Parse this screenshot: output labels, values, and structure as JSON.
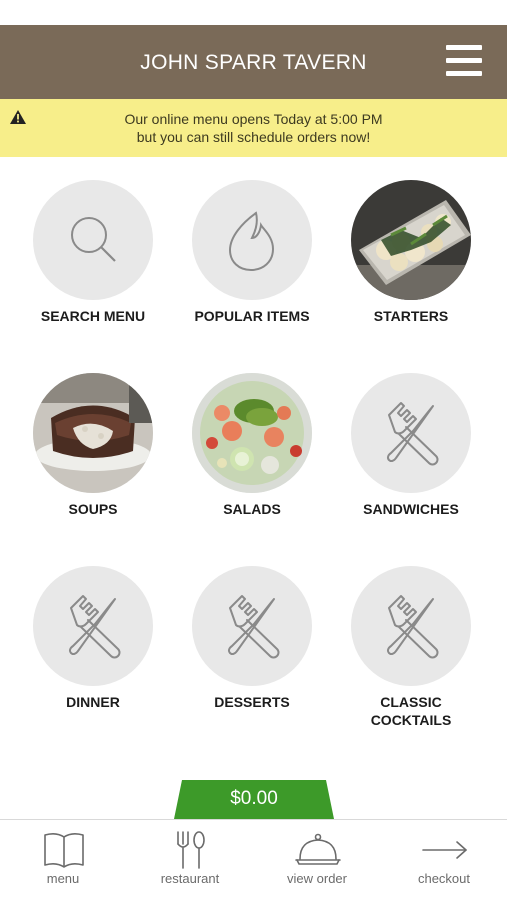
{
  "header": {
    "title": "JOHN SPARR TAVERN",
    "menu_icon": "hamburger-menu-icon"
  },
  "banner": {
    "icon": "warning-icon",
    "line1": "Our online menu opens Today at 5:00 PM",
    "line2": "but you can still schedule orders now!"
  },
  "categories": [
    {
      "label": "SEARCH MENU",
      "icon": "search-icon"
    },
    {
      "label": "POPULAR ITEMS",
      "icon": "flame-icon"
    },
    {
      "label": "STARTERS",
      "icon": "starters-photo"
    },
    {
      "label": "SOUPS",
      "icon": "soups-photo"
    },
    {
      "label": "SALADS",
      "icon": "salads-photo"
    },
    {
      "label": "SANDWICHES",
      "icon": "fork-knife-icon"
    },
    {
      "label": "DINNER",
      "icon": "fork-knife-icon"
    },
    {
      "label": "DESSERTS",
      "icon": "fork-knife-icon"
    },
    {
      "label": "CLASSIC",
      "label2": "COCKTAILS",
      "icon": "fork-knife-icon"
    }
  ],
  "cart": {
    "total": "$0.00"
  },
  "nav": [
    {
      "label": "menu",
      "icon": "book-icon"
    },
    {
      "label": "restaurant",
      "icon": "utensils-icon"
    },
    {
      "label": "view order",
      "icon": "cloche-icon"
    },
    {
      "label": "checkout",
      "icon": "arrow-right-icon"
    }
  ],
  "colors": {
    "header": "#7a6a58",
    "banner": "#f7ee8a",
    "accent": "#3d9a29",
    "tile": "#e8e8e8"
  }
}
